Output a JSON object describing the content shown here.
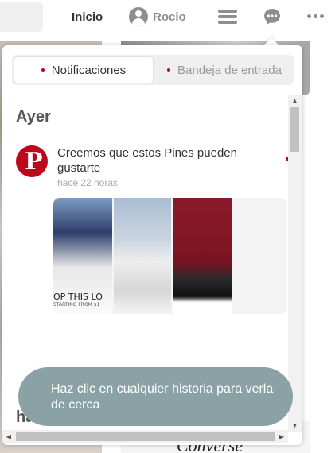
{
  "header": {
    "home_label": "Inicio",
    "user_name": "Rocio",
    "icons": [
      "user-avatar-icon",
      "menu-icon",
      "chat-icon",
      "more-icon"
    ]
  },
  "popup": {
    "tabs": [
      {
        "label": "Notificaciones",
        "active": true
      },
      {
        "label": "Bandeja de entrada",
        "active": false
      }
    ],
    "sections": [
      {
        "title": "Ayer",
        "notification": {
          "text": "Creemos que estos Pines pueden gustarte",
          "time": "hace 22 horas",
          "thumbnail_caption": "OP THIS LO",
          "thumbnail_subcaption": "STARTING FROM $1"
        }
      },
      {
        "title": "ha"
      }
    ]
  },
  "tooltip": {
    "text": "Haz clic en cualquier historia para verla de cerca"
  },
  "background": {
    "brand_text": "Converse"
  },
  "colors": {
    "pinterest_red": "#bd081c",
    "tooltip_bg": "#8aa2a6"
  }
}
